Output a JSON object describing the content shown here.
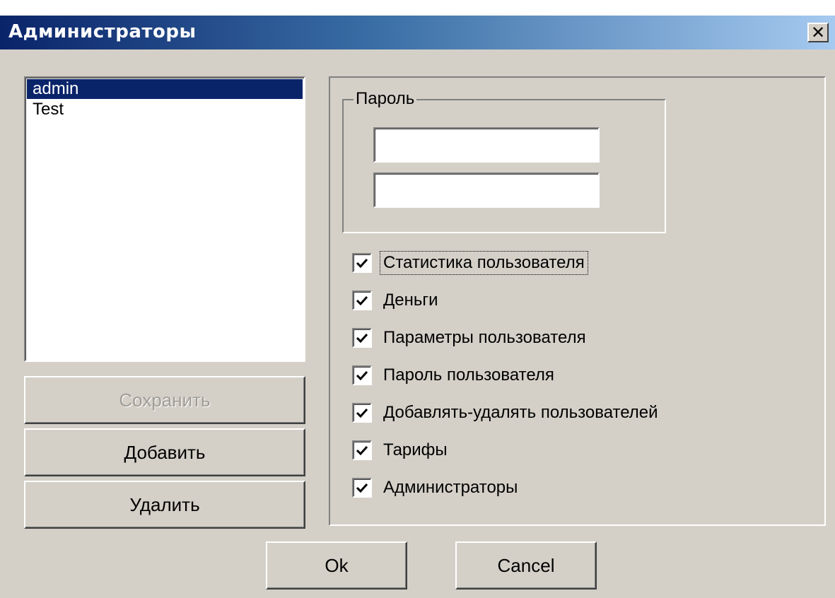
{
  "window": {
    "title": "Администраторы",
    "close_label": "✕"
  },
  "users": {
    "items": [
      {
        "label": "admin",
        "selected": true
      },
      {
        "label": "Test",
        "selected": false
      }
    ]
  },
  "actions": {
    "save_label": "Сохранить",
    "save_disabled": true,
    "add_label": "Добавить",
    "delete_label": "Удалить"
  },
  "password_group": {
    "label": "Пароль",
    "password_value": "",
    "confirm_value": ""
  },
  "permissions": [
    {
      "label": "Статистика пользователя",
      "checked": true,
      "focused": true
    },
    {
      "label": "Деньги",
      "checked": true,
      "focused": false
    },
    {
      "label": "Параметры пользователя",
      "checked": true,
      "focused": false
    },
    {
      "label": "Пароль пользователя",
      "checked": true,
      "focused": false
    },
    {
      "label": "Добавлять-удалять пользователей",
      "checked": true,
      "focused": false
    },
    {
      "label": "Тарифы",
      "checked": true,
      "focused": false
    },
    {
      "label": "Администраторы",
      "checked": true,
      "focused": false
    }
  ],
  "footer": {
    "ok_label": "Ok",
    "cancel_label": "Cancel"
  },
  "colors": {
    "selection": "#0a246a",
    "face": "#d4d0c8",
    "title_start": "#0a246a",
    "title_end": "#a6caf0"
  }
}
